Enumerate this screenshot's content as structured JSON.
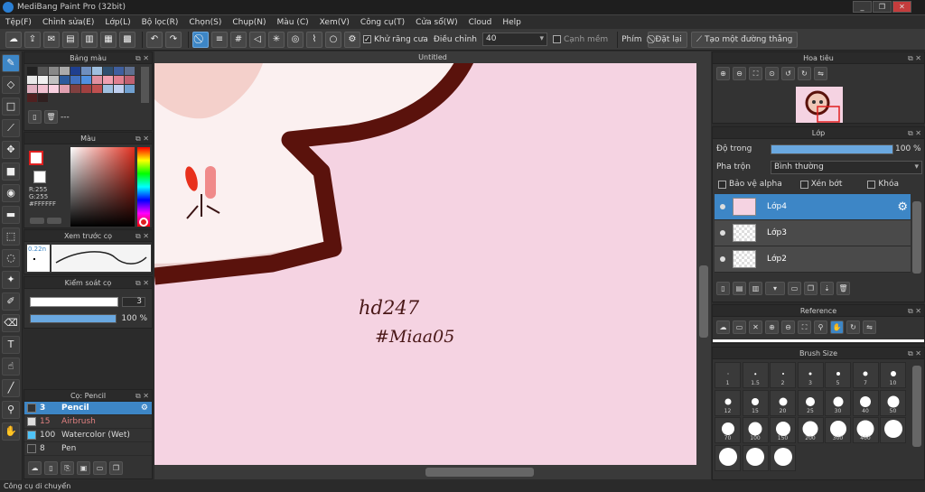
{
  "window": {
    "title": "MediBang Paint Pro (32bit)",
    "buttons": [
      "_",
      "❐",
      "✕",
      "▁",
      "□",
      "✕"
    ]
  },
  "menu": [
    "Tệp(F)",
    "Chỉnh sửa(E)",
    "Lớp(L)",
    "Bộ lọc(R)",
    "Chọn(S)",
    "Chụp(N)",
    "Màu (C)",
    "Xem(V)",
    "Công cụ(T)",
    "Cửa sổ(W)",
    "Cloud",
    "Help"
  ],
  "toolbar": {
    "antialias_label": "Khử răng cưa",
    "adjust_label": "Điều chỉnh",
    "adjust_value": "40",
    "edge_label": "Cạnh mềm",
    "key_label": "Phím",
    "reset_label": "Đặt lại",
    "straight_label": "Tạo một đường thẳng"
  },
  "document": {
    "tab": "Untitled"
  },
  "canvas": {
    "text1": "hd247",
    "text2": "#Miaa05",
    "bg_color": "#f5d3e2",
    "outline_color": "#5a120c"
  },
  "palette_panel": {
    "title": "Bảng màu",
    "footer": "---",
    "colors": [
      "#222222",
      "#555555",
      "#888888",
      "#aaaaaa",
      "#1f3f8f",
      "#6f8fbf",
      "#9fbfdf",
      "#2f4f6f",
      "#3f5f9f",
      "#5f6f8f",
      "#e8e8e8",
      "#f0f0f0",
      "#c0c0c0",
      "#2b5a9c",
      "#4070c0",
      "#5090e0",
      "#e090a0",
      "#f0a0b0",
      "#e08090",
      "#c06070",
      "#e0b0c0",
      "#f0c0d0",
      "#f8d0e0",
      "#e0a0b0",
      "#804040",
      "#a04040",
      "#c05050",
      "#a0c0e0",
      "#c0d0f0",
      "#70a0d0",
      "#502020",
      "#302020"
    ]
  },
  "color_panel": {
    "title": "Màu",
    "r": "R:255",
    "g": "G:255",
    "hex": "#FFFFFF"
  },
  "preview_panel": {
    "title": "Xem trước cọ",
    "size": "0.22n"
  },
  "brush_control": {
    "title": "Kiểm soát cọ",
    "size_value": "3",
    "opacity_value": "100 %",
    "size_fraction": 0.97,
    "opacity_fraction": 1.0
  },
  "brush_list": {
    "title": "Cọ: Pencil",
    "items": [
      {
        "num": "3",
        "name": "Pencil",
        "color": "#333333"
      },
      {
        "num": "15",
        "name": "Airbrush",
        "color": "#dddddd"
      },
      {
        "num": "100",
        "name": "Watercolor (Wet)",
        "color": "#4fc3f7"
      },
      {
        "num": "8",
        "name": "Pen",
        "color": "#333333"
      }
    ]
  },
  "navigator": {
    "title": "Hoa tiêu"
  },
  "layer_panel": {
    "title": "Lớp",
    "opacity_label": "Độ trong",
    "opacity_value": "100 %",
    "opacity_fraction": 1.0,
    "blend_label": "Pha trộn",
    "blend_value": "Bình thường",
    "alpha_label": "Bảo vệ alpha",
    "clip_label": "Xén bớt",
    "lock_label": "Khóa",
    "layers": [
      "Lớp4",
      "Lớp3",
      "Lớp2"
    ]
  },
  "reference_panel": {
    "title": "Reference"
  },
  "brush_size_panel": {
    "title": "Brush Size",
    "sizes": [
      "1",
      "1.5",
      "2",
      "3",
      "5",
      "7",
      "10",
      "12",
      "15",
      "20",
      "25",
      "30",
      "40",
      "50",
      "70",
      "100",
      "150",
      "200",
      "300",
      "400",
      "",
      "",
      "",
      ""
    ]
  },
  "status": "Công cụ di chuyển"
}
